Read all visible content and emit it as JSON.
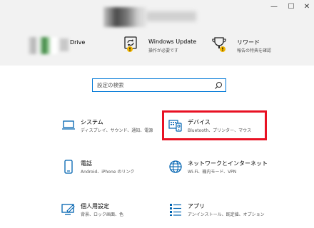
{
  "window": {
    "minimize": "—",
    "maximize": "☐",
    "close": "✕"
  },
  "header": {
    "drive_label": "Drive",
    "items": [
      {
        "title": "Windows Update",
        "subtitle": "操作が必要です"
      },
      {
        "title": "リワード",
        "subtitle": "報告の特典を確認"
      }
    ]
  },
  "search": {
    "placeholder": "設定の検索"
  },
  "tiles": [
    {
      "title": "システム",
      "desc": "ディスプレイ、サウンド、通知、電源"
    },
    {
      "title": "デバイス",
      "desc": "Bluetooth、プリンター、マウス"
    },
    {
      "title": "電話",
      "desc": "Android、iPhone のリンク"
    },
    {
      "title": "ネットワークとインターネット",
      "desc": "Wi-Fi、機内モード、VPN"
    },
    {
      "title": "個人用設定",
      "desc": "背景、ロック画面、色"
    },
    {
      "title": "アプリ",
      "desc": "アンインストール、既定値、オプション"
    }
  ],
  "colors": {
    "accent": "#0078d7",
    "highlight": "#e81123",
    "warning_badge": "#f0b400"
  }
}
